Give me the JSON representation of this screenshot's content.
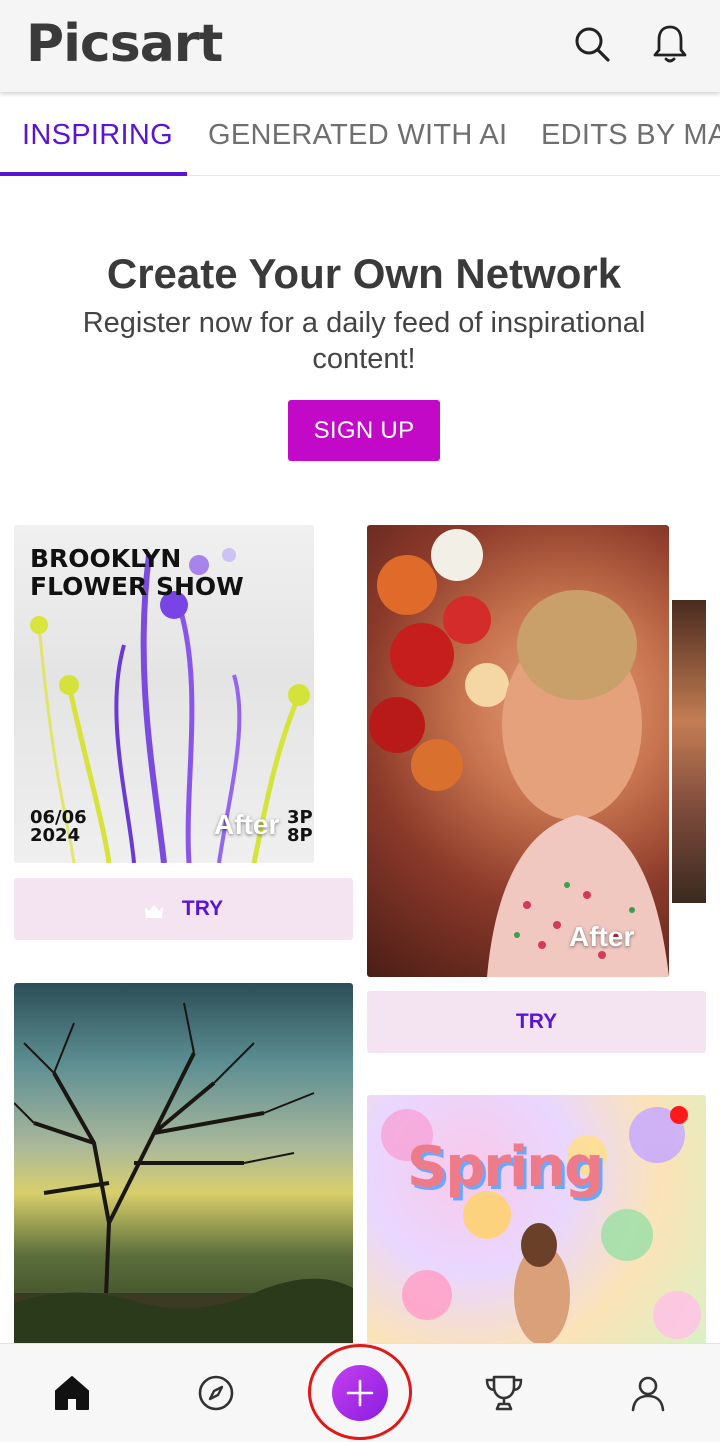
{
  "header": {
    "app_name": "Picsart",
    "search_icon": "search-icon",
    "notifications_icon": "bell-icon"
  },
  "tabs": [
    {
      "label": "INSPIRING",
      "active": true
    },
    {
      "label": "GENERATED WITH AI",
      "active": false
    },
    {
      "label": "EDITS BY MA",
      "active": false
    }
  ],
  "promo": {
    "title": "Create Your Own Network",
    "subtitle": "Register now for a daily feed of inspirational content!",
    "signup_label": "SIGN UP"
  },
  "feed": [
    {
      "poster_title_line1": "BROOKLYN",
      "poster_title_line2": "FLOWER SHOW",
      "poster_date_line1": "06/06",
      "poster_date_line2": "2024",
      "poster_time_line1": "3P",
      "poster_time_line2": "8P",
      "after_label": "After",
      "try_label": "TRY",
      "has_crown": true
    },
    {
      "after_label": "After",
      "try_label": "TRY",
      "has_crown": false
    },
    {
      "description_icon": "tree-landscape"
    },
    {
      "sticker_text": "Spring"
    }
  ],
  "bottom_nav": {
    "items": [
      "home-icon",
      "compass-icon",
      "plus-icon",
      "trophy-icon",
      "profile-icon"
    ]
  },
  "colors": {
    "accent": "#5a14d6",
    "signup": "#c209c7",
    "try_bg": "#f4e4f1",
    "highlight_ring": "#e01818"
  }
}
